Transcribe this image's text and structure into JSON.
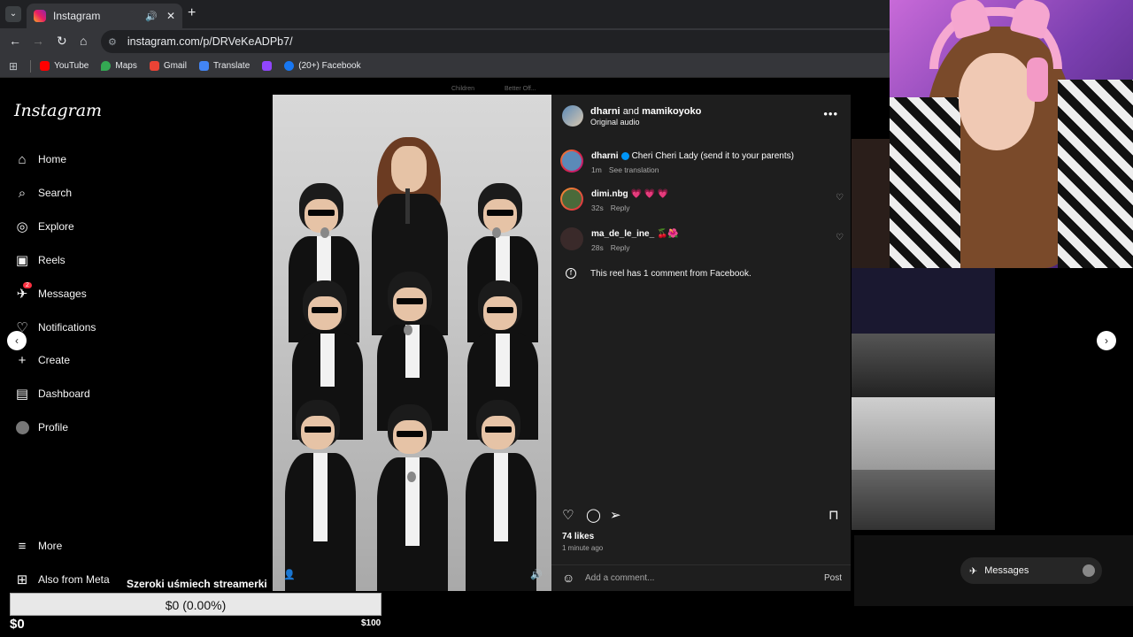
{
  "browser": {
    "tab_title": "Instagram",
    "url": "instagram.com/p/DRVeKeADPb7/",
    "bookmarks": [
      "YouTube",
      "Maps",
      "Gmail",
      "Translate",
      "(20+) Facebook"
    ]
  },
  "sidebar": {
    "logo": "Instagram",
    "items": [
      {
        "label": "Home",
        "icon": "home-icon"
      },
      {
        "label": "Search",
        "icon": "search-icon"
      },
      {
        "label": "Explore",
        "icon": "compass-icon"
      },
      {
        "label": "Reels",
        "icon": "reels-icon"
      },
      {
        "label": "Messages",
        "icon": "messenger-icon"
      },
      {
        "label": "Notifications",
        "icon": "heart-icon"
      },
      {
        "label": "Create",
        "icon": "plus-icon"
      },
      {
        "label": "Dashboard",
        "icon": "dashboard-icon"
      },
      {
        "label": "Profile",
        "icon": "avatar-icon"
      }
    ],
    "more": "More",
    "also_from_meta": "Also from Meta",
    "messages_badge": "2"
  },
  "stories_hint": [
    "Children",
    "Better Off..."
  ],
  "post": {
    "author_1": "dharni",
    "joiner": "and",
    "author_2": "mamikoyoko",
    "audio": "Original audio",
    "caption": {
      "user": "dharni",
      "text": "Cheri Cheri Lady (send it to your parents)",
      "time": "1m",
      "translate": "See translation"
    },
    "comments": [
      {
        "user": "dimi.nbg",
        "text": "💗 💗 💗",
        "time": "32s",
        "reply": "Reply"
      },
      {
        "user": "ma_de_le_ine_",
        "text": "🍒🌺",
        "time": "28s",
        "reply": "Reply"
      }
    ],
    "facebook_note": "This reel has 1 comment from Facebook.",
    "likes": "74 likes",
    "posted": "1 minute ago",
    "add_comment_placeholder": "Add a comment...",
    "post_button": "Post"
  },
  "messages_pill": "Messages",
  "overlay": {
    "goal_title": "Szeroki uśmiech streamerki",
    "progress_text": "$0 (0.00%)",
    "progress_fraction": 0.0,
    "min": "$0",
    "max": "$100"
  },
  "colors": {
    "instagram_bg": "#000000",
    "panel_bg": "#1e1e1e",
    "accent": "#0095f6",
    "webcam_bg": "#9b4fd0"
  }
}
